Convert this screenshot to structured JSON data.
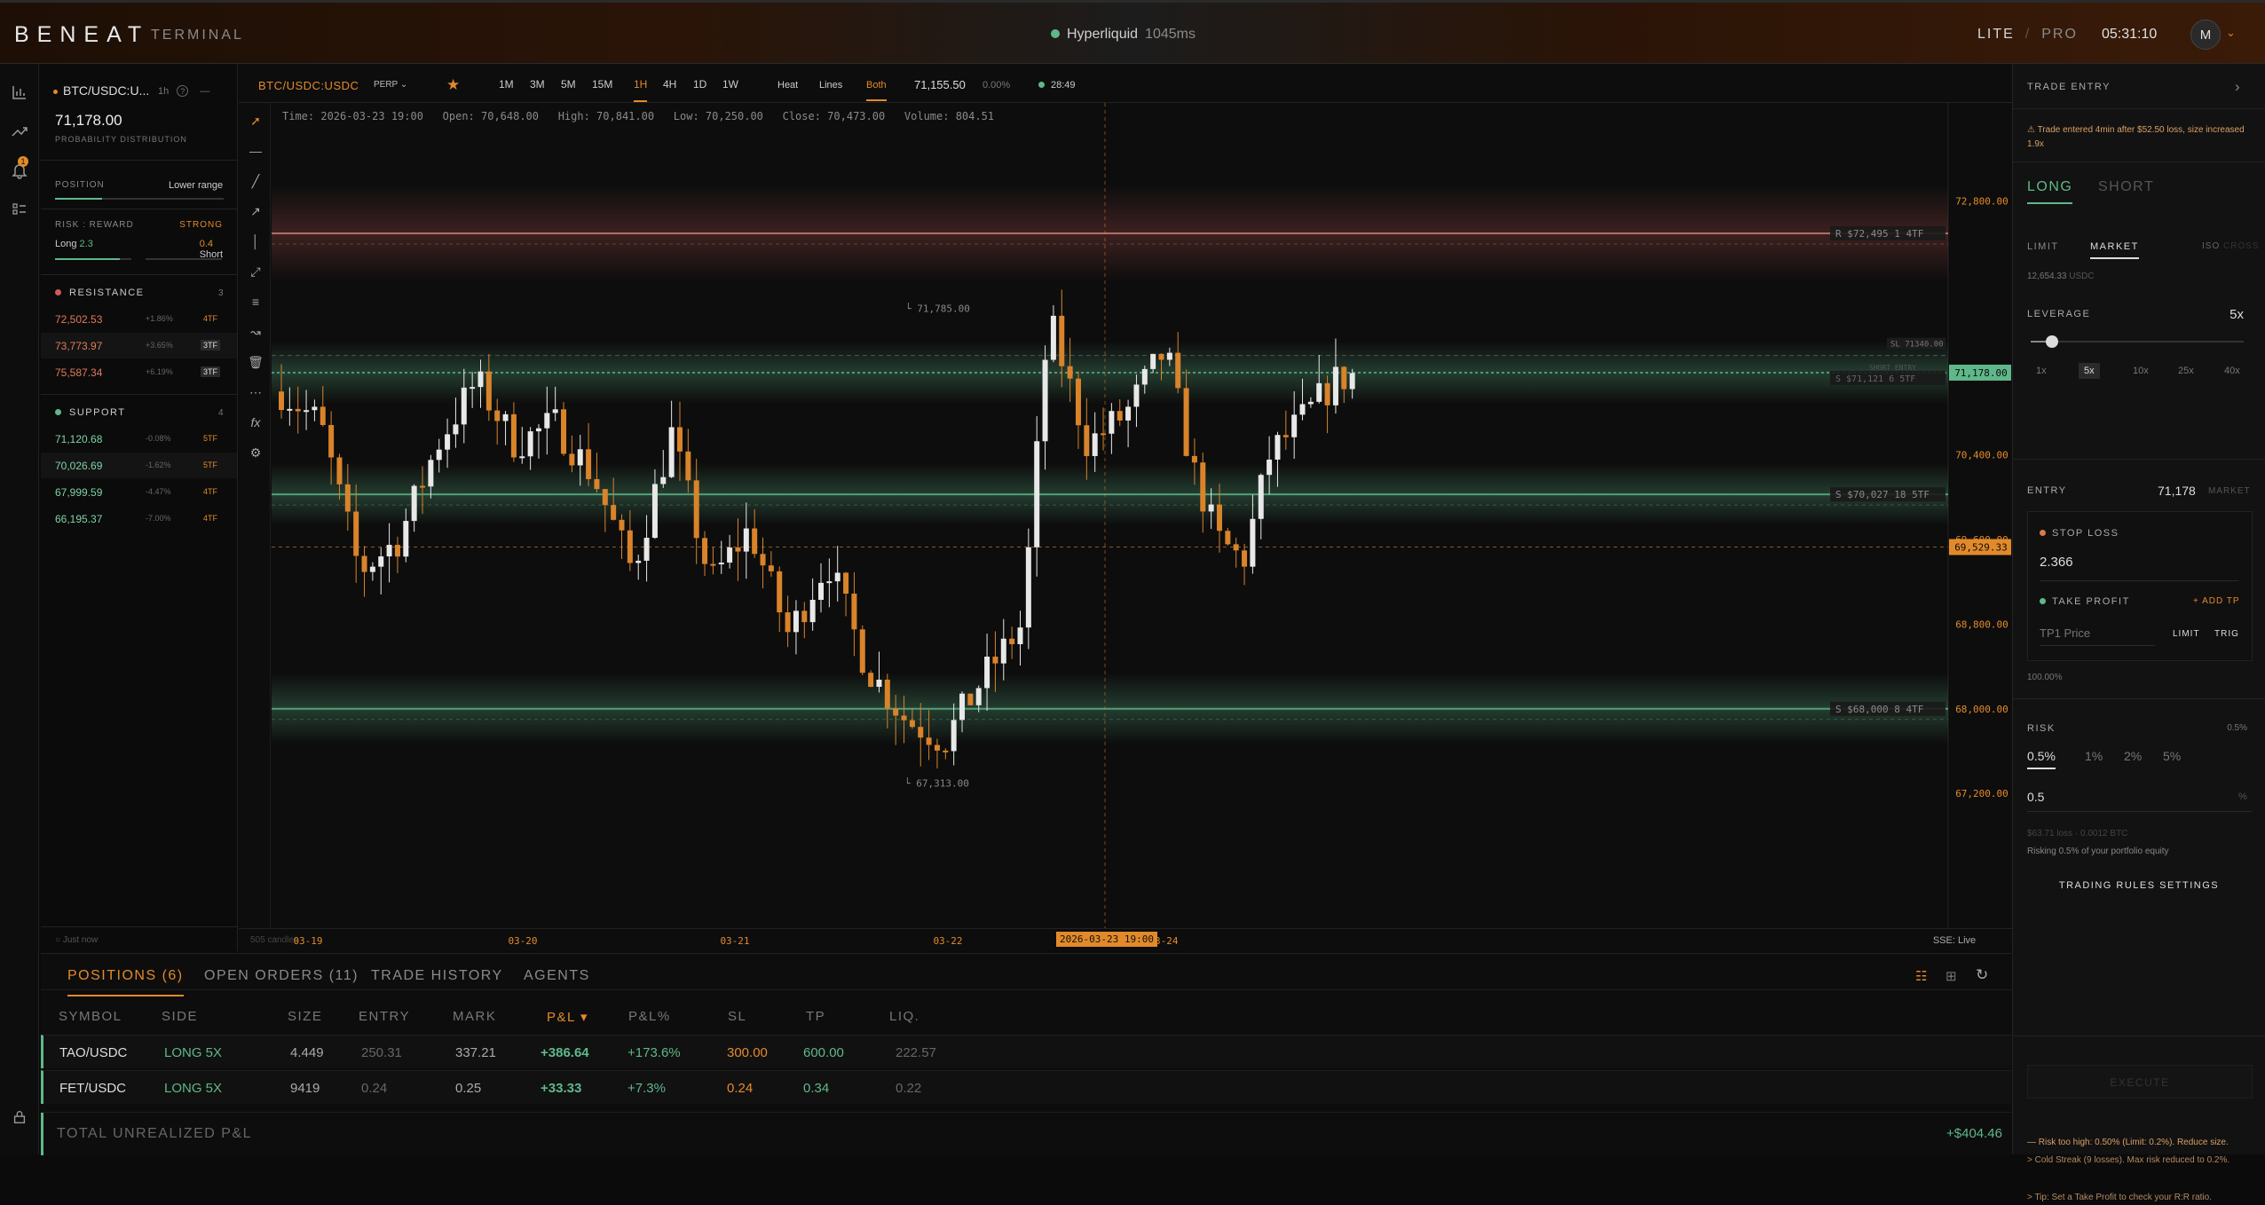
{
  "header": {
    "logo": "BENEAT",
    "subtitle": "TERMINAL",
    "exchange": "Hyperliquid",
    "latency": "1045ms",
    "mode_lite": "LITE",
    "mode_sep": "/",
    "mode_pro": "PRO",
    "clock": "05:31:10",
    "avatar": "M",
    "avatar_chevron": "⌄"
  },
  "rail": {
    "notif_count": "1"
  },
  "left_panel": {
    "symbol": "BTC/USDC:U...",
    "timeframe": "1h",
    "info": "?",
    "dash": "—",
    "price": "71,178.00",
    "prob_label": "PROBABILITY DISTRIBUTION",
    "position_label": "POSITION",
    "position_value": "Lower range",
    "position_fraction": 0.28,
    "rr_label": "RISK : REWARD",
    "rr_value": "STRONG",
    "long_label": "Long",
    "long_value": "2.3",
    "short_value": "0.4",
    "short_label": "Short",
    "long_fraction": 0.85,
    "resistance_label": "RESISTANCE",
    "resistance_count": "3",
    "resistance": [
      {
        "price": "72,502.53",
        "pct": "+1.86%",
        "tf": "4TF"
      },
      {
        "price": "73,773.97",
        "pct": "+3.65%",
        "tf": "3TF"
      },
      {
        "price": "75,587.34",
        "pct": "+6.19%",
        "tf": "3TF"
      }
    ],
    "support_label": "SUPPORT",
    "support_count": "4",
    "support": [
      {
        "price": "71,120.68",
        "pct": "-0.08%",
        "tf": "5TF"
      },
      {
        "price": "70,026.69",
        "pct": "-1.62%",
        "tf": "5TF"
      },
      {
        "price": "67,999.59",
        "pct": "-4.47%",
        "tf": "4TF"
      },
      {
        "price": "66,195.37",
        "pct": "-7.00%",
        "tf": "4TF"
      }
    ],
    "footer": "○ Just now",
    "colors": {
      "accent": "#e28a2a",
      "green": "#5fb88a",
      "red": "#d15a5a"
    }
  },
  "chart_toolbar": {
    "symbol": "BTC/USDC:USDC",
    "market": "PERP ⌄",
    "timeframes": [
      "1M",
      "3M",
      "5M",
      "15M",
      "1H",
      "4H",
      "1D",
      "1W"
    ],
    "active_tf": "1H",
    "views": [
      "Heat",
      "Lines",
      "Both"
    ],
    "active_view": "Both",
    "price": "71,155.50",
    "change": "0.00%",
    "timer": "28:49"
  },
  "ohlc": {
    "time": "Time: 2026-03-23 19:00",
    "open": "Open: 70,648.00",
    "high": "High: 70,841.00",
    "low": "Low: 70,250.00",
    "close": "Close: 70,473.00",
    "volume": "Volume: 804.51"
  },
  "chart_data": {
    "type": "candlestick",
    "y_ticks": [
      72800,
      70400,
      69600,
      68800,
      68000,
      67200
    ],
    "x_ticks": [
      "03-19",
      "03-20",
      "03-21",
      "03-22",
      "03-24"
    ],
    "crosshair_time": "2026-03-23 19:00",
    "crosshair_price": "69,529.33",
    "last_price": "71,178.00",
    "high_label": "71,785.00",
    "low_label": "67,313.00",
    "levels": [
      {
        "label": "R  $72,495  1  4TF",
        "price": 72495,
        "kind": "resistance"
      },
      {
        "label": "S  $70,027  18  5TF",
        "price": 70027,
        "kind": "support"
      },
      {
        "label": "S  $68,000  8  4TF",
        "price": 68000,
        "kind": "support"
      }
    ],
    "sl_tag": "SL 71340.00",
    "short_tag": "SHORT ENTRY",
    "s_tag": "S  $71,121  6  5TF",
    "candles_count_label": "505 candles",
    "sse_status": "SSE: Live"
  },
  "bottom": {
    "tabs": [
      "POSITIONS (6)",
      "OPEN ORDERS (11)",
      "TRADE HISTORY",
      "AGENTS"
    ],
    "headers": [
      "SYMBOL",
      "SIDE",
      "SIZE",
      "ENTRY",
      "MARK",
      "P&L ▾",
      "P&L%",
      "SL",
      "TP",
      "LIQ."
    ],
    "rows": [
      {
        "symbol": "TAO/USDC",
        "side": "LONG 5X",
        "size": "4.449",
        "entry": "250.31",
        "mark": "337.21",
        "pnl": "+386.64",
        "pnlpct": "+173.6%",
        "sl": "300.00",
        "tp": "600.00",
        "liq": "222.57"
      },
      {
        "symbol": "FET/USDC",
        "side": "LONG 5X",
        "size": "9419",
        "entry": "0.24",
        "mark": "0.25",
        "pnl": "+33.33",
        "pnlpct": "+7.3%",
        "sl": "0.24",
        "tp": "0.34",
        "liq": "0.22"
      }
    ],
    "total_label": "TOTAL UNREALIZED P&L",
    "total_value": "+$404.46"
  },
  "right_panel": {
    "title": "TRADE ENTRY",
    "chevron": "›",
    "warning": "⚠ Trade entered 4min after $52.50 loss, size increased 1.9x",
    "long": "LONG",
    "short": "SHORT",
    "limit": "LIMIT",
    "market": "MARKET",
    "iso": "ISO",
    "cross": "CROSS",
    "balance": "12,654.33",
    "balance_unit": "USDC",
    "leverage_label": "LEVERAGE",
    "leverage_value": "5x",
    "leverage_fraction": 0.1,
    "lev_opts": [
      "1x",
      "5x",
      "10x",
      "25x",
      "40x"
    ],
    "active_lev": "5x",
    "entry_label": "ENTRY",
    "entry_value": "71,178",
    "entry_type": "MARKET",
    "sl_label": "STOP LOSS",
    "sl_value": "2.366",
    "tp_label": "TAKE PROFIT",
    "tp_add": "+ ADD TP",
    "tp_placeholder": "TP1 Price",
    "tp_limit": "LIMIT",
    "tp_trig": "TRIG",
    "tp_pct": "100.00%",
    "risk_label": "RISK",
    "risk_value": "0.5%",
    "risk_opts": [
      "0.5%",
      "1%",
      "2%",
      "5%"
    ],
    "risk_input": "0.5",
    "risk_unit": "%",
    "risk_note": "$63.71 loss · 0.0012 BTC",
    "risk_desc": "Risking 0.5% of your portfolio equity",
    "rules": "TRADING RULES SETTINGS",
    "execute": "EXECUTE",
    "alerts": [
      "— Risk too high: 0.50% (Limit: 0.2%). Reduce size.",
      "> Cold Streak (9 losses). Max risk reduced to 0.2%.",
      "> Tip: Set a Take Profit to check your R:R ratio."
    ]
  }
}
